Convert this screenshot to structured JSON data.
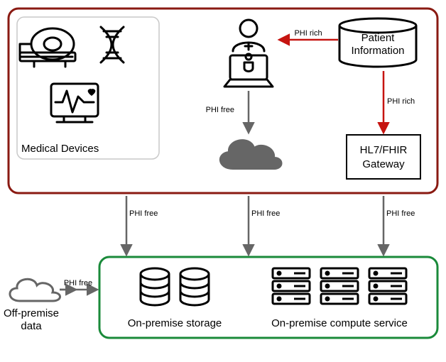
{
  "labels": {
    "medical_devices": "Medical Devices",
    "patient_info_l1": "Patient",
    "patient_info_l2": "Information",
    "gateway_l1": "HL7/FHIR",
    "gateway_l2": "Gateway",
    "off_premise_l1": "Off-premise",
    "off_premise_l2": "data",
    "on_prem_storage": "On-premise storage",
    "on_prem_compute": "On-premise compute service"
  },
  "edges": {
    "phi_rich": "PHI rich",
    "phi_free": "PHI free"
  },
  "colors": {
    "outer_top": "#8a1a12",
    "outer_bottom": "#1a8a3a",
    "phi_rich": "#c61410",
    "neutral": "#666666",
    "box": "#000000"
  }
}
